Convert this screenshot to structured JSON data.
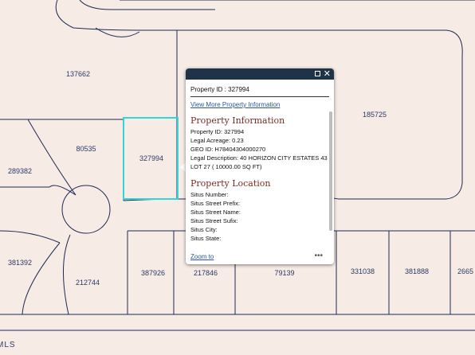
{
  "map": {
    "background_color": "#f7ebe6",
    "line_color": "#1e2a55",
    "selected_color": "#33d6d6",
    "parcels": [
      {
        "id": "137662"
      },
      {
        "id": "185725"
      },
      {
        "id": "80535"
      },
      {
        "id": "327994",
        "selected": true
      },
      {
        "id": "289382"
      },
      {
        "id": "381392"
      },
      {
        "id": "212744"
      },
      {
        "id": "387926"
      },
      {
        "id": "217846"
      },
      {
        "id": "79139"
      },
      {
        "id": "331038"
      },
      {
        "id": "381888"
      },
      {
        "id": "2665"
      }
    ],
    "footer_text": "MLS"
  },
  "popup": {
    "property_id_label": "Property ID : 327994",
    "more_info_link": "View More Property Information",
    "info_section_title": "Property Information",
    "info_fields": [
      "Property ID: 327994",
      "Legal Acreage: 0.23",
      "GEO ID: H78404304000270",
      "Legal Description: 40 HORIZON CITY ESTATES 43 LOT 27 ( 10000.00 SQ FT)"
    ],
    "location_section_title": "Property Location",
    "location_fields": [
      "Situs Number:",
      "Situs Street Prefix:",
      "Situs Street Name:",
      "Situs Street Sufix:",
      "Situs City:",
      "Situs State:"
    ],
    "zoom_link": "Zoom to",
    "more_icon": "ellipsis-icon",
    "close_icon": "close-icon",
    "maximize_icon": "maximize-icon"
  }
}
